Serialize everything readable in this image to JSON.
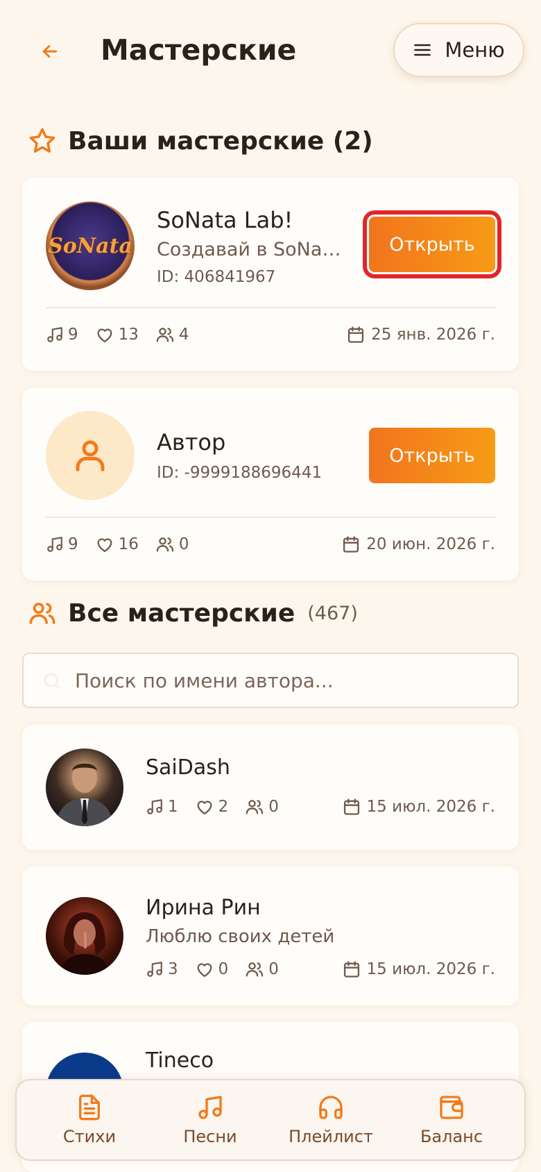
{
  "header": {
    "title": "Мастерские",
    "menu_label": "Меню"
  },
  "own_section": {
    "title": "Ваши мастерские (2)",
    "cards": [
      {
        "name": "SoNata Lab!",
        "description": "Создавай в SoNata Lab!",
        "id_text": "ID: 406841967",
        "avatar_text": "SoNata",
        "open_label": "Открыть",
        "songs": "9",
        "likes": "13",
        "members": "4",
        "date": "25 янв. 2026 г."
      },
      {
        "name": "Автор",
        "id_text": "ID: -9999188696441",
        "open_label": "Открыть",
        "songs": "9",
        "likes": "16",
        "members": "0",
        "date": "20 июн. 2026 г."
      }
    ]
  },
  "all_section": {
    "title": "Все мастерские",
    "count": "(467)",
    "search_placeholder": "Поиск по имени автора...",
    "rows": [
      {
        "name": "SaiDash",
        "description": "",
        "songs": "1",
        "likes": "2",
        "members": "0",
        "date": "15 июл. 2026 г."
      },
      {
        "name": "Ирина Рин",
        "description": "Люблю своих детей",
        "songs": "3",
        "likes": "0",
        "members": "0",
        "date": "15 июл. 2026 г."
      },
      {
        "name": "Tineco"
      }
    ]
  },
  "bottom_nav": {
    "items": [
      {
        "label": "Стихи",
        "icon": "document-icon"
      },
      {
        "label": "Песни",
        "icon": "music-note-icon"
      },
      {
        "label": "Плейлист",
        "icon": "headphones-icon"
      },
      {
        "label": "Баланс",
        "icon": "wallet-icon"
      }
    ]
  },
  "colors": {
    "accent": "#f27a1a",
    "background": "#fdf6ec",
    "highlight": "#e1262b"
  }
}
